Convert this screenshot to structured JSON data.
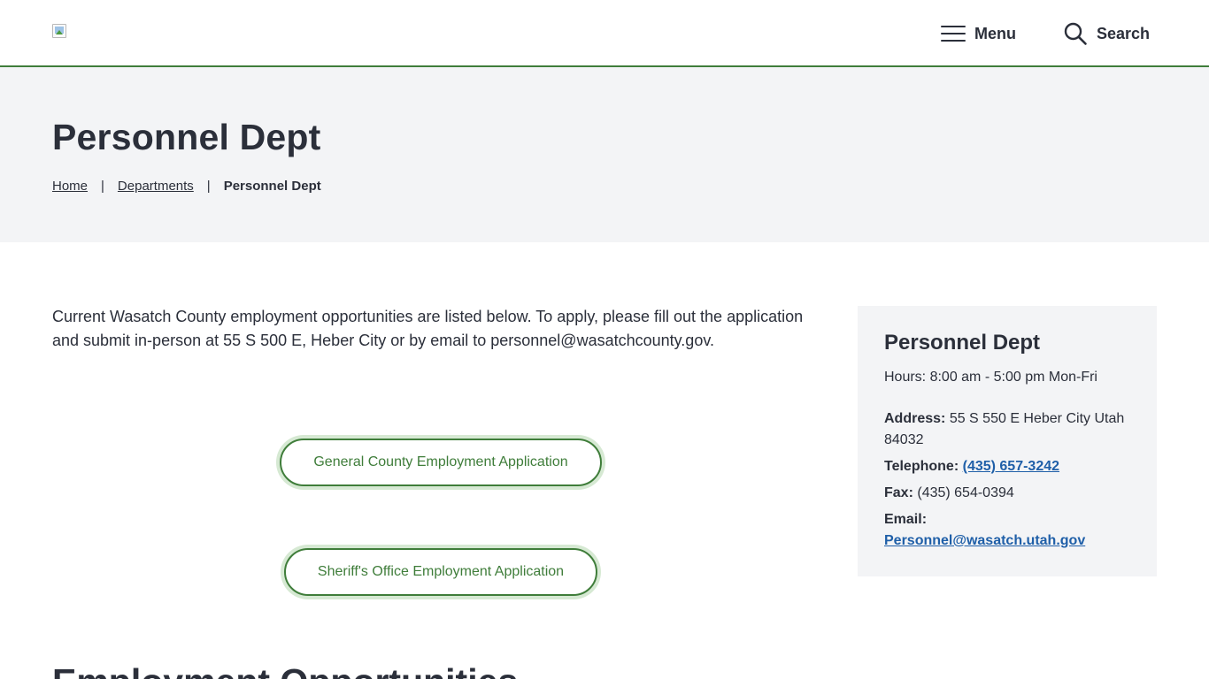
{
  "header": {
    "logo_alt": "Wasatch County",
    "menu_label": "Menu",
    "search_label": "Search"
  },
  "hero": {
    "title": "Personnel Dept",
    "breadcrumb": {
      "home": "Home",
      "sep1": "|",
      "departments": "Departments",
      "sep2": "|",
      "current": "Personnel Dept"
    }
  },
  "main": {
    "intro": "Current Wasatch County employment opportunities are listed below. To apply, please fill out the application and submit in-person at 55 S 500 E, Heber City or by email to personnel@wasatchcounty.gov.",
    "buttons": {
      "general": "General County Employment Application",
      "sheriff": "Sheriff's Office Employment Application"
    },
    "section_heading": "Employment Opportunities"
  },
  "sidebar": {
    "title": "Personnel Dept",
    "hours": "Hours: 8:00 am - 5:00 pm Mon-Fri",
    "address_label": "Address:",
    "address_value": "55 S 550 E Heber City Utah 84032",
    "telephone_label": "Telephone:",
    "telephone_value": "(435) 657-3242",
    "fax_label": "Fax:",
    "fax_value": "(435) 654-0394",
    "email_label": "Email:",
    "email_value": "Personnel@wasatch.utah.gov"
  },
  "colors": {
    "accent_green": "#3f7d3a",
    "link_blue": "#1f5fa8",
    "panel_gray": "#f3f4f6",
    "text_dark": "#2b2f3a"
  }
}
